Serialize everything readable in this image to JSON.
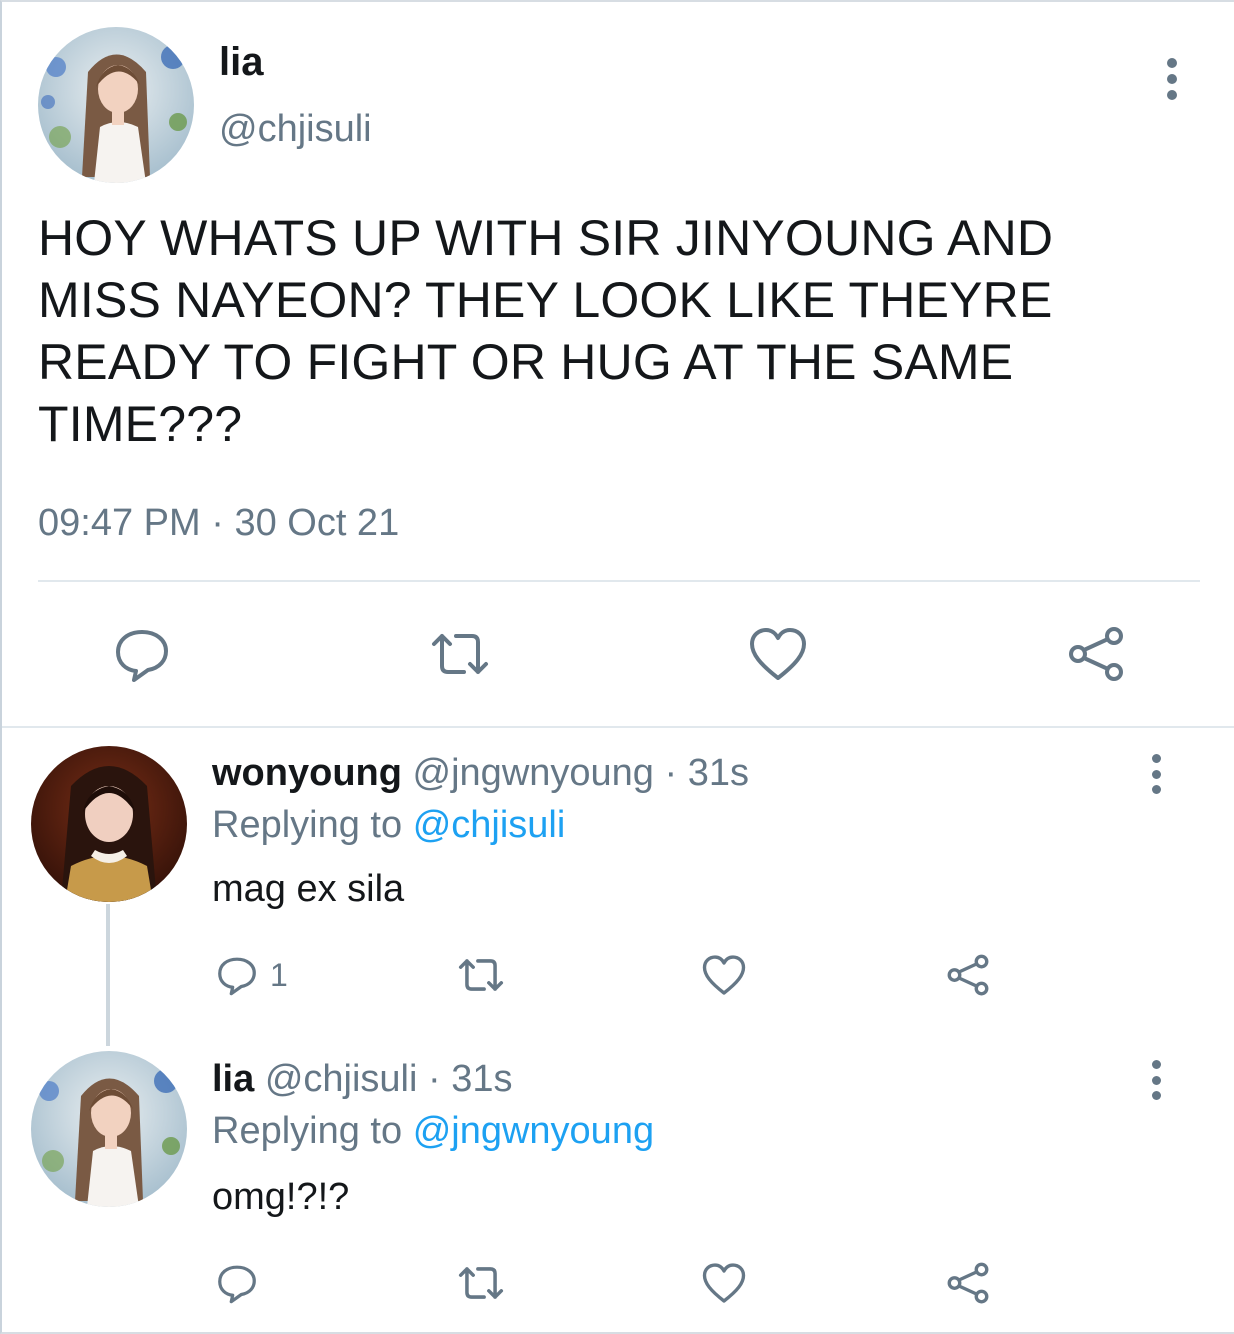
{
  "main_tweet": {
    "author_name": "lia",
    "author_handle": "@chjisuli",
    "text": "HOY WHATS UP WITH SIR JINYOUNG AND MISS NAYEON? THEY LOOK LIKE THEYRE READY TO FIGHT OR HUG AT THE SAME TIME???",
    "time": "09:47 PM",
    "date": "30 Oct 21",
    "separator": "·",
    "actions": [
      {
        "icon": "reply-icon"
      },
      {
        "icon": "retweet-icon"
      },
      {
        "icon": "like-icon"
      },
      {
        "icon": "share-icon"
      }
    ]
  },
  "replies": [
    {
      "name": "wonyoung",
      "handle": "@jngwnyoung",
      "age": "31s",
      "separator": "·",
      "replying_label": "Replying to",
      "replying_to": "@chjisuli",
      "text": "mag ex sila",
      "reply_count": "1"
    },
    {
      "name": "lia",
      "handle": "@chjisuli",
      "age": "31s",
      "separator": "·",
      "replying_label": "Replying to",
      "replying_to": "@jngwnyoung",
      "text": "omg!?!?",
      "reply_count": ""
    }
  ],
  "colors": {
    "text": "#14171a",
    "secondary": "#657786",
    "link": "#1da1f2",
    "divider": "#e1e8ed"
  }
}
